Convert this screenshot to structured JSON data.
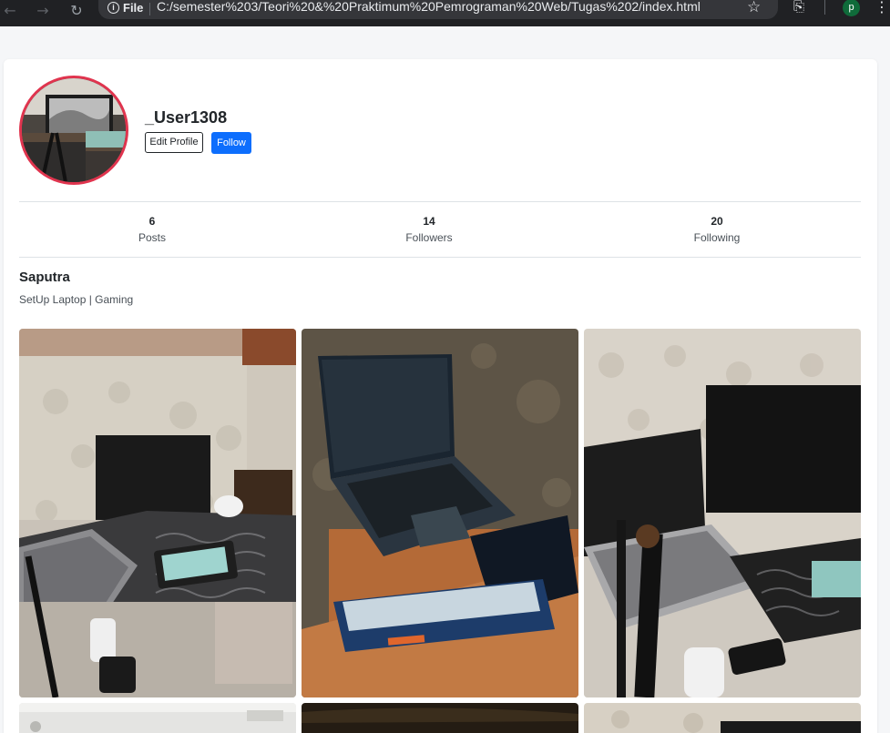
{
  "browser": {
    "file_label": "File",
    "url": "C:/semester%203/Teori%20&%20Praktimum%20Pemrograman%20Web/Tugas%202/index.html",
    "profile_initial": "p"
  },
  "profile": {
    "username": "_User1308",
    "edit_label": "Edit Profile",
    "follow_label": "Follow",
    "full_name": "Saputra",
    "bio": "SetUp Laptop | Gaming"
  },
  "stats": [
    {
      "value": "6",
      "label": "Posts"
    },
    {
      "value": "14",
      "label": "Followers"
    },
    {
      "value": "20",
      "label": "Following"
    }
  ],
  "colors": {
    "accent": "#0d6efd",
    "avatar_ring": "#e0344e",
    "divider": "#dee2e6"
  },
  "posts": [
    {
      "subject": "desk-setup-laptop-keyboard"
    },
    {
      "subject": "gaming-laptop-outdoor-keyboard"
    },
    {
      "subject": "laptop-monitor-mic-setup"
    },
    {
      "subject": "ceiling-photo"
    },
    {
      "subject": "dark-photo"
    },
    {
      "subject": "wall-photo"
    }
  ]
}
